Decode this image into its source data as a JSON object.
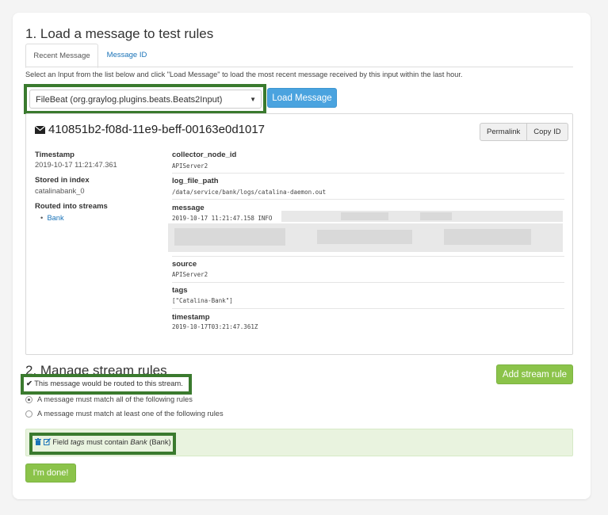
{
  "section1": {
    "title": "1. Load a message to test rules"
  },
  "tabs": [
    {
      "label": "Recent Message",
      "active": true
    },
    {
      "label": "Message ID",
      "active": false
    }
  ],
  "help_text": "Select an Input from the list below and click \"Load Message\" to load the most recent message received by this input within the last hour.",
  "input_select": {
    "value": "FileBeat (org.graylog.plugins.beats.Beats2Input)"
  },
  "load_button": "Load Message",
  "message": {
    "id": "410851b2-f08d-11e9-beff-00163e0d1017",
    "permalink_label": "Permalink",
    "copy_id_label": "Copy ID",
    "meta": {
      "timestamp_label": "Timestamp",
      "timestamp_value": "2019-10-17 11:21:47.361",
      "index_label": "Stored in index",
      "index_value": "catalinabank_0",
      "streams_label": "Routed into streams",
      "streams": [
        "Bank"
      ]
    },
    "fields": {
      "collector_node_id": {
        "name": "collector_node_id",
        "value": "APIServer2"
      },
      "log_file_path": {
        "name": "log_file_path",
        "value": "/data/service/bank/logs/catalina-daemon.out"
      },
      "message": {
        "name": "message",
        "value": "2019-10-17 11:21:47.158 INFO"
      },
      "source": {
        "name": "source",
        "value": "APIServer2"
      },
      "tags": {
        "name": "tags",
        "value": "[\"Catalina-Bank\"]"
      },
      "timestamp": {
        "name": "timestamp",
        "value": "2019-10-17T03:21:47.361Z"
      }
    }
  },
  "section2": {
    "title": "2. Manage stream rules",
    "add_rule_button": "Add stream rule",
    "routed_notice": "This message would be routed to this stream.",
    "match_all_label": "A message must match all of the following rules",
    "match_any_label": "A message must match at least one of the following rules",
    "rule": {
      "prefix": "Field",
      "field": "tags",
      "middle": "must contain",
      "value": "Bank",
      "stream": "(Bank)"
    },
    "done_button": "I'm done!"
  },
  "colors": {
    "highlight": "#3a7a2e",
    "primary": "#4aa3df",
    "success": "#8bc34a",
    "link": "#1a73b8",
    "rule_bg": "#e9f3df"
  }
}
